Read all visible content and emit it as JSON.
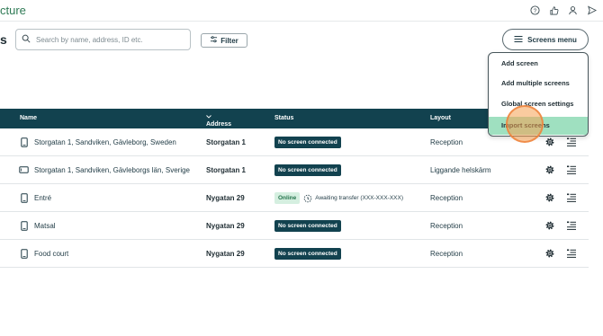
{
  "topbar": {
    "brand_text": "cture",
    "icons": [
      "help-icon",
      "thumbs-up-icon",
      "user-icon",
      "send-icon"
    ]
  },
  "page": {
    "title_fragment": "s"
  },
  "toolbar": {
    "search_placeholder": "Search by name, address, ID etc.",
    "filter_label": "Filter",
    "screens_menu_label": "Screens menu"
  },
  "table": {
    "headers": {
      "name": "Name",
      "address": "Address",
      "status": "Status",
      "layout": "Layout"
    },
    "rows": [
      {
        "icon": "portrait-screen-icon",
        "name": "Storgatan 1, Sandviken, Gävleborg, Sweden",
        "address": "Storgatan 1",
        "status": "No screen connected",
        "layout": "Reception"
      },
      {
        "icon": "landscape-screen-icon",
        "name": "Storgatan 1, Sandviken, Gävleborgs län, Sverige",
        "address": "Storgatan 1",
        "status": "No screen connected",
        "layout": "Liggande helskärm"
      },
      {
        "icon": "portrait-screen-icon",
        "name": "Entré",
        "address": "Nygatan 29",
        "status": "Online",
        "status_extra": "Awaiting transfer (XXX-XXX-XXX)",
        "layout": "Reception"
      },
      {
        "icon": "portrait-screen-icon",
        "name": "Matsal",
        "address": "Nygatan 29",
        "status": "No screen connected",
        "layout": "Reception"
      },
      {
        "icon": "portrait-screen-icon",
        "name": "Food court",
        "address": "Nygatan 29",
        "status": "No screen connected",
        "layout": "Reception"
      }
    ]
  },
  "screens_menu": {
    "items": [
      "Add screen",
      "Add multiple screens",
      "Global screen settings",
      "Import screens"
    ],
    "highlighted_index": 3
  },
  "colors": {
    "header_bg": "#12424f",
    "brand": "#2f7a55",
    "highlight": "#9fe0c0",
    "online_bg": "#d5efe0"
  }
}
